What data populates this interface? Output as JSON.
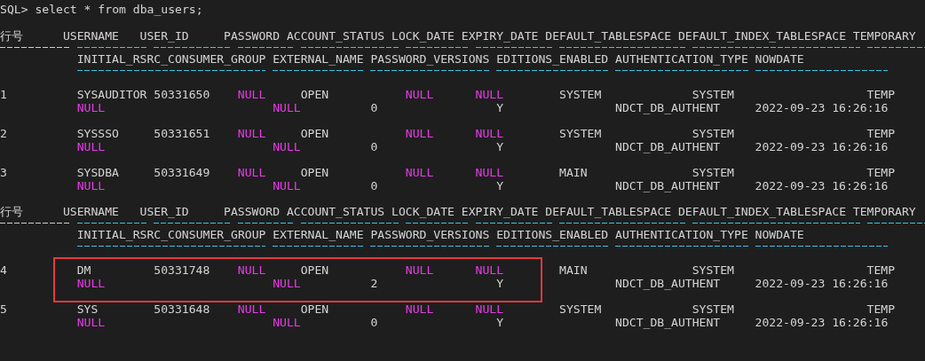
{
  "prompt": "SQL>",
  "command": "select * from dba_users;",
  "result_pages": [
    {
      "row_number_header": "行号",
      "header_line_1": [
        "USERNAME",
        "USER_ID",
        "PASSWORD",
        "ACCOUNT_STATUS",
        "LOCK_DATE",
        "EXPIRY_DATE",
        "DEFAULT_TABLESPACE",
        "DEFAULT_INDEX_TABLESPACE",
        "TEMPORARY"
      ],
      "header_line_2": [
        "INITIAL_RSRC_CONSUMER_GROUP",
        "EXTERNAL_NAME",
        "PASSWORD_VERSIONS",
        "EDITIONS_ENABLED",
        "AUTHENTICATION_TYPE",
        "NOWDATE"
      ],
      "rows": [
        {
          "row_number": "1",
          "highlighted": false,
          "line_1": [
            "SYSAUDITOR",
            "50331650",
            {
              "text": "NULL",
              "kind": "null"
            },
            "OPEN",
            {
              "text": "NULL",
              "kind": "null"
            },
            {
              "text": "NULL",
              "kind": "null"
            },
            "SYSTEM",
            "SYSTEM",
            "TEMP"
          ],
          "line_2": [
            {
              "text": "NULL",
              "kind": "null"
            },
            {
              "text": "NULL",
              "kind": "null"
            },
            "0",
            "Y",
            "NDCT_DB_AUTHENT",
            "2022-09-23 16:26:16"
          ]
        },
        {
          "row_number": "2",
          "highlighted": false,
          "line_1": [
            "SYSSSO",
            "50331651",
            {
              "text": "NULL",
              "kind": "null"
            },
            "OPEN",
            {
              "text": "NULL",
              "kind": "null"
            },
            {
              "text": "NULL",
              "kind": "null"
            },
            "SYSTEM",
            "SYSTEM",
            "TEMP"
          ],
          "line_2": [
            {
              "text": "NULL",
              "kind": "null"
            },
            {
              "text": "NULL",
              "kind": "null"
            },
            "0",
            "Y",
            "NDCT_DB_AUTHENT",
            "2022-09-23 16:26:16"
          ]
        },
        {
          "row_number": "3",
          "highlighted": false,
          "line_1": [
            "SYSDBA",
            "50331649",
            {
              "text": "NULL",
              "kind": "null"
            },
            "OPEN",
            {
              "text": "NULL",
              "kind": "null"
            },
            {
              "text": "NULL",
              "kind": "null"
            },
            "MAIN",
            "SYSTEM",
            "TEMP"
          ],
          "line_2": [
            {
              "text": "NULL",
              "kind": "null"
            },
            {
              "text": "NULL",
              "kind": "null"
            },
            "0",
            "Y",
            "NDCT_DB_AUTHENT",
            "2022-09-23 16:26:16"
          ]
        }
      ]
    },
    {
      "row_number_header": "行号",
      "header_line_1": [
        "USERNAME",
        "USER_ID",
        "PASSWORD",
        "ACCOUNT_STATUS",
        "LOCK_DATE",
        "EXPIRY_DATE",
        "DEFAULT_TABLESPACE",
        "DEFAULT_INDEX_TABLESPACE",
        "TEMPORARY"
      ],
      "header_line_2": [
        "INITIAL_RSRC_CONSUMER_GROUP",
        "EXTERNAL_NAME",
        "PASSWORD_VERSIONS",
        "EDITIONS_ENABLED",
        "AUTHENTICATION_TYPE",
        "NOWDATE"
      ],
      "rows": [
        {
          "row_number": "4",
          "highlighted": true,
          "line_1": [
            "DM",
            "50331748",
            {
              "text": "NULL",
              "kind": "null"
            },
            "OPEN",
            {
              "text": "NULL",
              "kind": "null"
            },
            {
              "text": "NULL",
              "kind": "null"
            },
            "MAIN",
            "SYSTEM",
            "TEMP"
          ],
          "line_2": [
            {
              "text": "NULL",
              "kind": "null"
            },
            {
              "text": "NULL",
              "kind": "null"
            },
            "2",
            "Y",
            "NDCT_DB_AUTHENT",
            "2022-09-23 16:26:16"
          ]
        },
        {
          "row_number": "5",
          "highlighted": false,
          "line_1": [
            "SYS",
            "50331648",
            {
              "text": "NULL",
              "kind": "null"
            },
            "OPEN",
            {
              "text": "NULL",
              "kind": "null"
            },
            {
              "text": "NULL",
              "kind": "null"
            },
            "SYSTEM",
            "SYSTEM",
            "TEMP"
          ],
          "line_2": [
            {
              "text": "NULL",
              "kind": "null"
            },
            {
              "text": "NULL",
              "kind": "null"
            },
            "0",
            "Y",
            "NDCT_DB_AUTHENT",
            "2022-09-23 16:26:16"
          ]
        }
      ]
    }
  ]
}
